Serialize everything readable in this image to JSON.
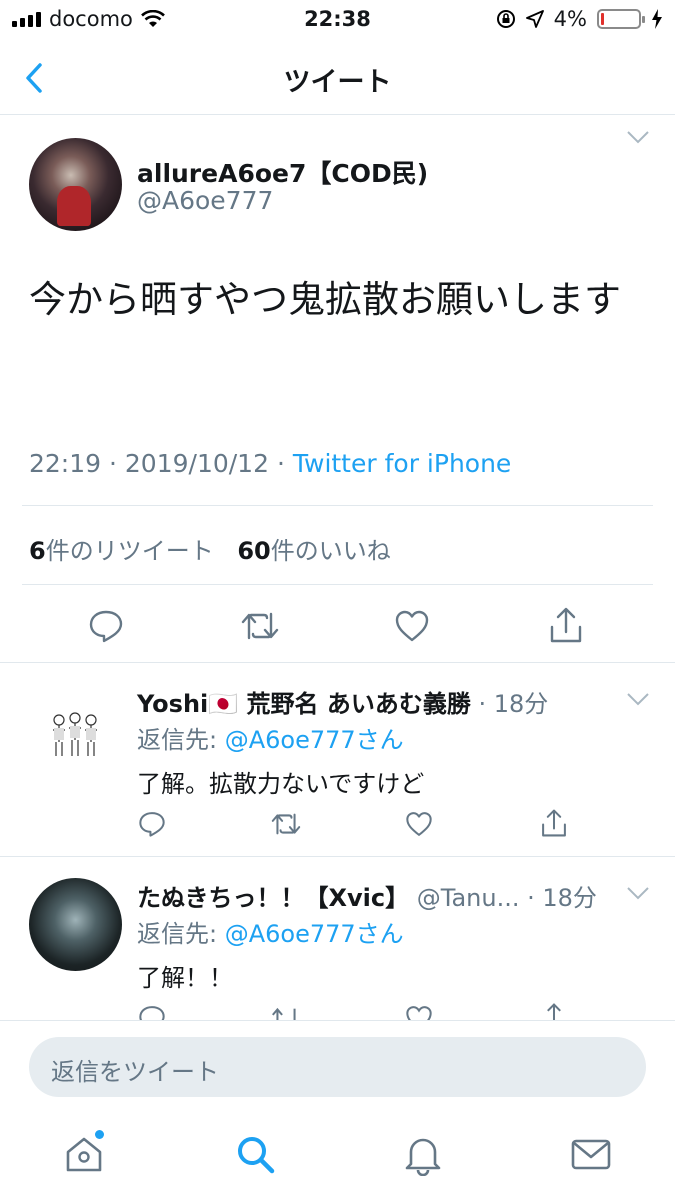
{
  "status_bar": {
    "carrier": "docomo",
    "time": "22:38",
    "battery": "4%",
    "battery_level": 0.04
  },
  "nav": {
    "title": "ツイート"
  },
  "tweet": {
    "display_name": "allureA6oe7【COD民)",
    "handle": "@A6oe777",
    "text": "今から晒すやつ鬼拡散お願いします",
    "time": "22:19",
    "date": "2019/10/12",
    "source": "Twitter for iPhone",
    "retweet_count": "6",
    "retweet_label": "件のリツイート",
    "like_count": "60",
    "like_label": "件のいいね"
  },
  "replies": [
    {
      "display_name": "Yoshi🇯🇵 荒野名 あいあむ義勝",
      "age": "18分",
      "reply_to_prefix": "返信先: ",
      "reply_to_handle": "@A6oe777さん",
      "text": "了解。拡散力ないですけど"
    },
    {
      "display_name": "たぬきちっ！！【Xvic】",
      "handle": "@Tanu...",
      "age": "18分",
      "reply_to_prefix": "返信先: ",
      "reply_to_handle": "@A6oe777さん",
      "text": "了解！！"
    }
  ],
  "composer": {
    "placeholder": "返信をツイート"
  },
  "tabs": [
    "home-icon",
    "search-icon",
    "notifications-icon",
    "messages-icon"
  ],
  "colors": {
    "accent": "#1da1f2",
    "secondary_text": "#657786",
    "divider": "#e1e8ed"
  }
}
